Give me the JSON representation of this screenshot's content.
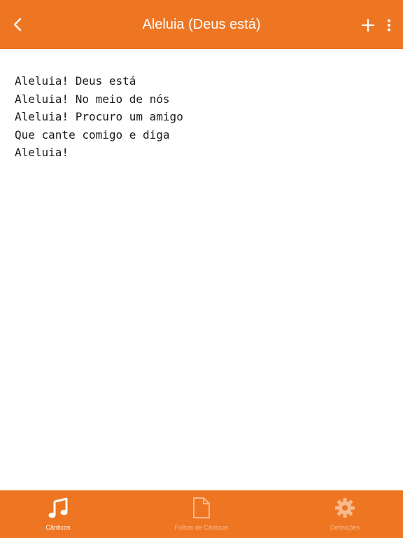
{
  "header": {
    "title": "Aleluia (Deus está)",
    "back_icon": "chevron-left-icon",
    "add_icon": "plus-icon",
    "more_icon": "more-vertical-icon"
  },
  "lyrics": {
    "lines": [
      "Aleluia! Deus está",
      "Aleluia! No meio de nós",
      "Aleluia! Procuro um amigo",
      "Que cante comigo e diga",
      "Aleluia!"
    ]
  },
  "tabs": [
    {
      "label": "Cânticos",
      "icon": "music-note-icon",
      "active": true
    },
    {
      "label": "Folhas de Cânticos",
      "icon": "document-icon",
      "active": false
    },
    {
      "label": "Definições",
      "icon": "gear-icon",
      "active": false
    }
  ],
  "colors": {
    "accent": "#EE7623",
    "inactive_tab": "#F7B98E",
    "text": "#1a1a1a"
  }
}
